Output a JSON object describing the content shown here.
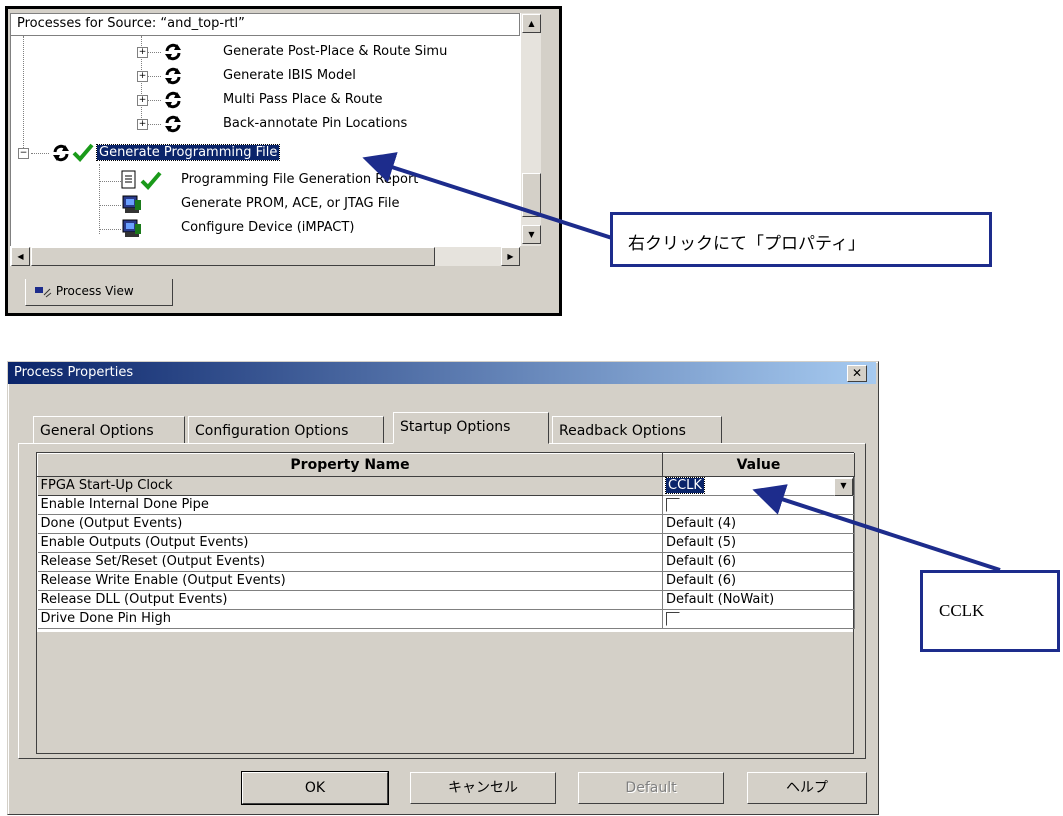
{
  "processes": {
    "header": "Processes for Source:  “and_top-rtl”",
    "items": [
      {
        "label": "Generate Post-Place & Route Simu"
      },
      {
        "label": "Generate IBIS Model"
      },
      {
        "label": "Multi Pass Place & Route"
      },
      {
        "label": "Back-annotate Pin Locations"
      },
      {
        "label": "Generate Programming File"
      },
      {
        "label": "Programming File Generation Report"
      },
      {
        "label": "Generate PROM, ACE, or JTAG File"
      },
      {
        "label": "Configure Device (iMPACT)"
      }
    ],
    "tab_label": "Process View"
  },
  "callouts": {
    "right_click": "右クリックにて「プロパティ」",
    "cclk": "CCLK"
  },
  "dialog": {
    "title": "Process Properties",
    "tabs": [
      "General Options",
      "Configuration Options",
      "Startup Options",
      "Readback Options"
    ],
    "active_tab": "Startup Options",
    "columns": [
      "Property Name",
      "Value"
    ],
    "rows": [
      {
        "name": "FPGA Start-Up Clock",
        "value": "CCLK"
      },
      {
        "name": "Enable Internal Done Pipe",
        "value": ""
      },
      {
        "name": "Done (Output Events)",
        "value": "Default (4)"
      },
      {
        "name": "Enable Outputs (Output Events)",
        "value": "Default (5)"
      },
      {
        "name": "Release Set/Reset (Output Events)",
        "value": "Default (6)"
      },
      {
        "name": "Release Write Enable (Output Events)",
        "value": "Default (6)"
      },
      {
        "name": "Release DLL (Output Events)",
        "value": "Default (NoWait)"
      },
      {
        "name": "Drive Done Pin High",
        "value": ""
      }
    ],
    "buttons": {
      "ok": "OK",
      "cancel": "キャンセル",
      "default": "Default",
      "help": "ヘルプ"
    }
  }
}
